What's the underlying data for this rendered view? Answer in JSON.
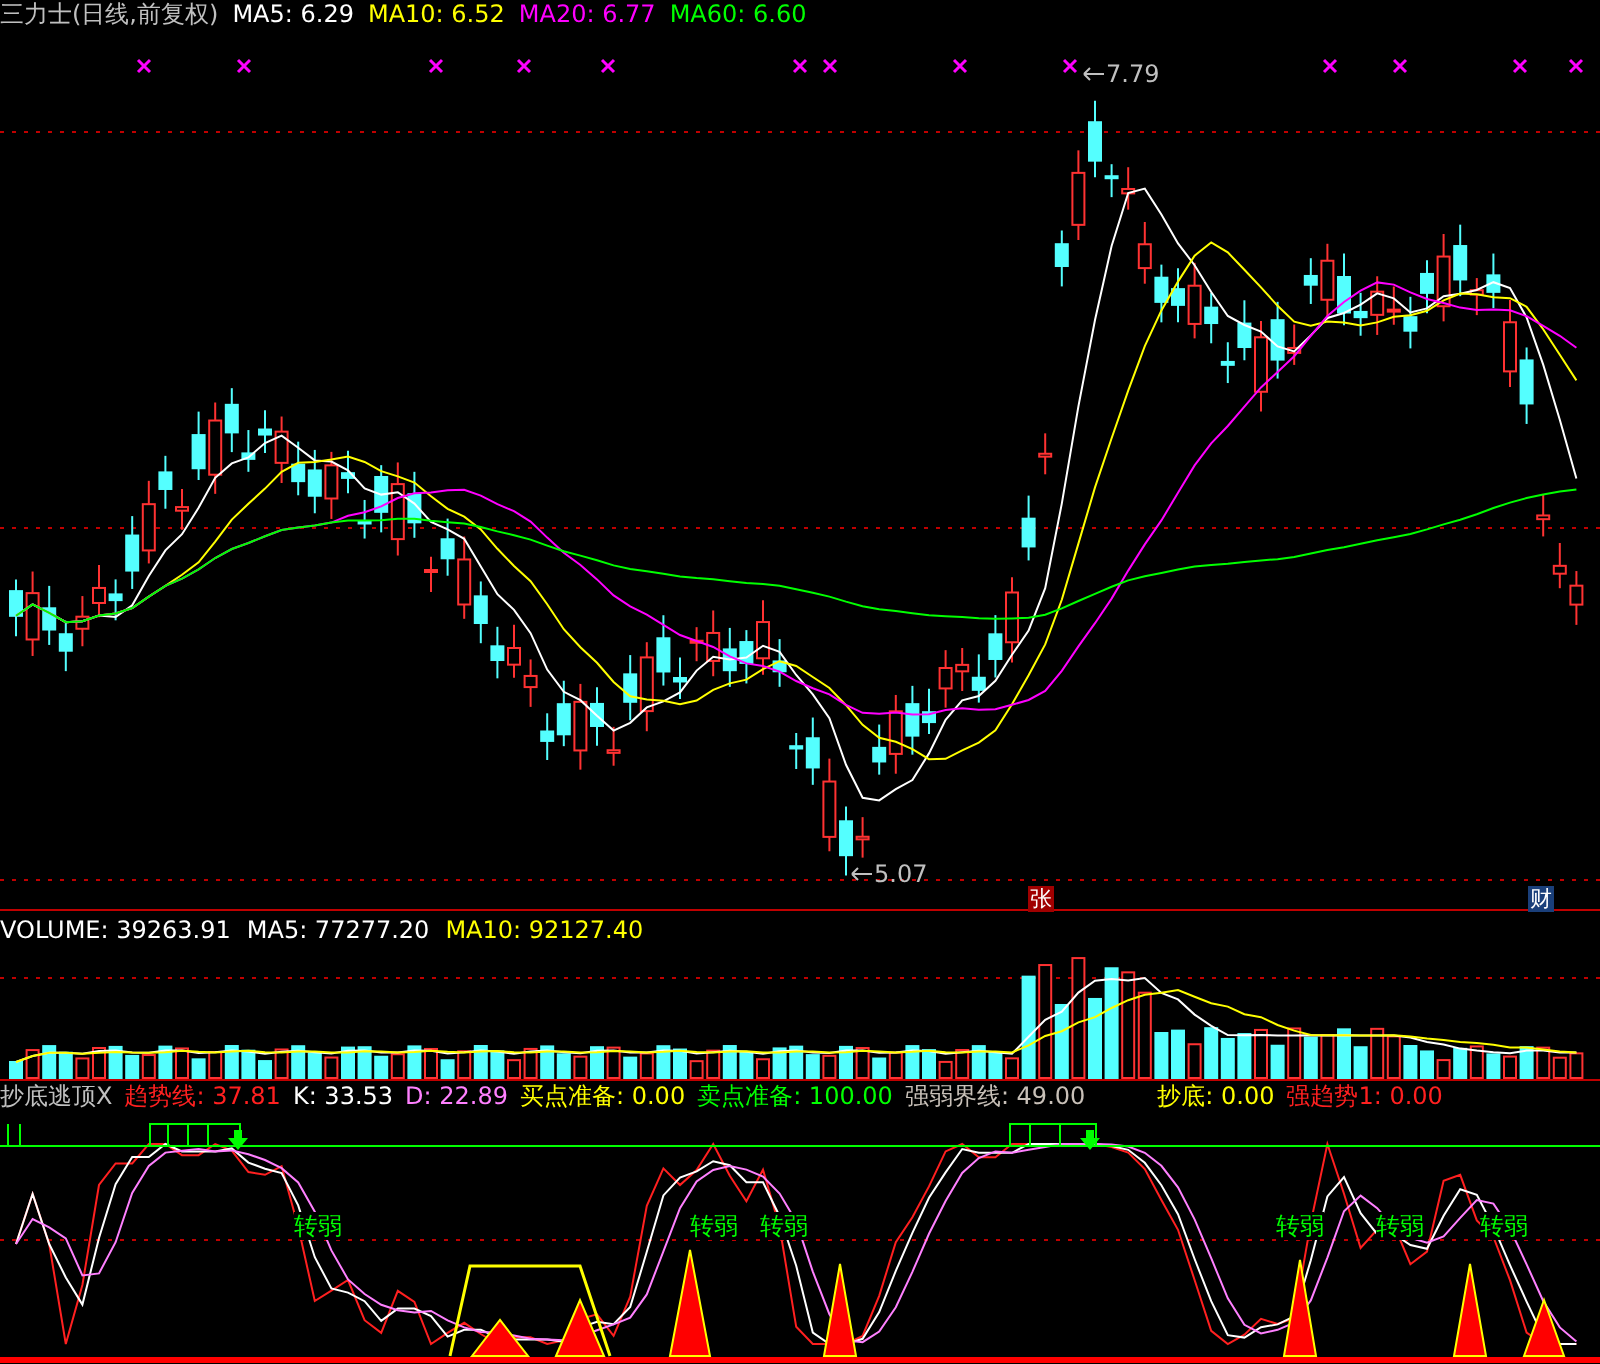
{
  "price_panel": {
    "title": "三力士(日线,前复权)",
    "indicators": [
      {
        "label": "MA5: 6.29",
        "color": "#ffffff"
      },
      {
        "label": "MA10: 6.52",
        "color": "#ffff00"
      },
      {
        "label": "MA20: 6.77",
        "color": "#ff00ff"
      },
      {
        "label": "MA60: 6.60",
        "color": "#00ff00"
      }
    ],
    "high_label": "7.79",
    "low_label": "5.07",
    "markers": [
      {
        "text": "张",
        "color": "#a00000"
      },
      {
        "text": "财",
        "color": "#1a3f7a"
      }
    ]
  },
  "volume_panel": {
    "indicators": [
      {
        "label": "VOLUME: 39263.91",
        "color": "#ffffff"
      },
      {
        "label": "MA5: 77277.20",
        "color": "#ffffff"
      },
      {
        "label": "MA10: 92127.40",
        "color": "#ffff00"
      }
    ]
  },
  "indicator_panel": {
    "title": "抄底逃顶X",
    "indicators": [
      {
        "label": "趋势线: 37.81",
        "color": "#ff2020"
      },
      {
        "label": "K: 33.53",
        "color": "#ffffff"
      },
      {
        "label": "D: 22.89",
        "color": "#ff80ff"
      },
      {
        "label": "买点准备: 0.00",
        "color": "#ffff00"
      },
      {
        "label": "卖点准备: 100.00",
        "color": "#00ff00"
      },
      {
        "label": "强弱界线: 49.00",
        "color": "#c8c0b8"
      },
      {
        "label": "抄底: 0.00",
        "color": "#ffff00"
      },
      {
        "label": "强趋势1: 0.00",
        "color": "#ff2020"
      }
    ],
    "signals": [
      "转弱",
      "转弱",
      "转弱",
      "转弱",
      "转弱",
      "转弱"
    ]
  }
}
